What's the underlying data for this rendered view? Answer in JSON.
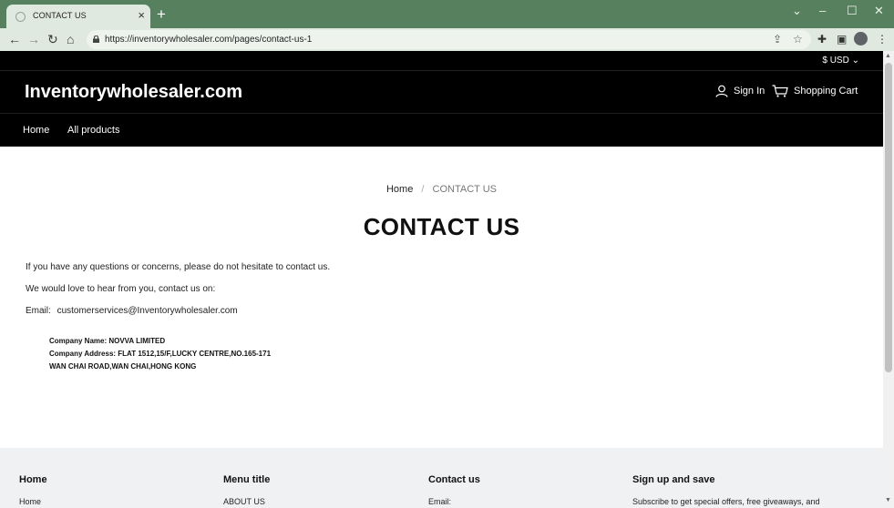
{
  "browser": {
    "tab_title": "CONTACT US",
    "url": "https://inventorywholesaler.com/pages/contact-us-1"
  },
  "header": {
    "currency": "$ USD",
    "logo": "Inventorywholesaler.com",
    "sign_in": "Sign In",
    "cart": "Shopping Cart"
  },
  "nav": {
    "items": [
      {
        "label": "Home"
      },
      {
        "label": "All products"
      }
    ]
  },
  "breadcrumb": {
    "home": "Home",
    "current": "CONTACT US"
  },
  "page": {
    "title": "CONTACT US",
    "intro": "If you have any questions or concerns, please do not hesitate to contact us.",
    "reach": "We would love to hear from you, contact us on:",
    "email_label": "Email:",
    "email_value": "customerservices@Inventorywholesaler.com",
    "company_name": "Company Name: NOVVA LIMITED",
    "company_address_1": "Company Address: FLAT 1512,15/F,LUCKY CENTRE,NO.165-171",
    "company_address_2": "WAN CHAI ROAD,WAN CHAI,HONG KONG"
  },
  "footer": {
    "columns": [
      {
        "heading": "Home",
        "first_item": "Home"
      },
      {
        "heading": "Menu title",
        "first_item": "ABOUT US"
      },
      {
        "heading": "Contact us",
        "first_item": "Email:"
      },
      {
        "heading": "Sign up and save",
        "first_item": "Subscribe to get special offers, free giveaways, and"
      }
    ]
  },
  "colors": {
    "browser_frame": "#57805f",
    "toolbar": "#dfe9df",
    "header_bg": "#000000",
    "footer_bg": "#f0f1f3"
  }
}
